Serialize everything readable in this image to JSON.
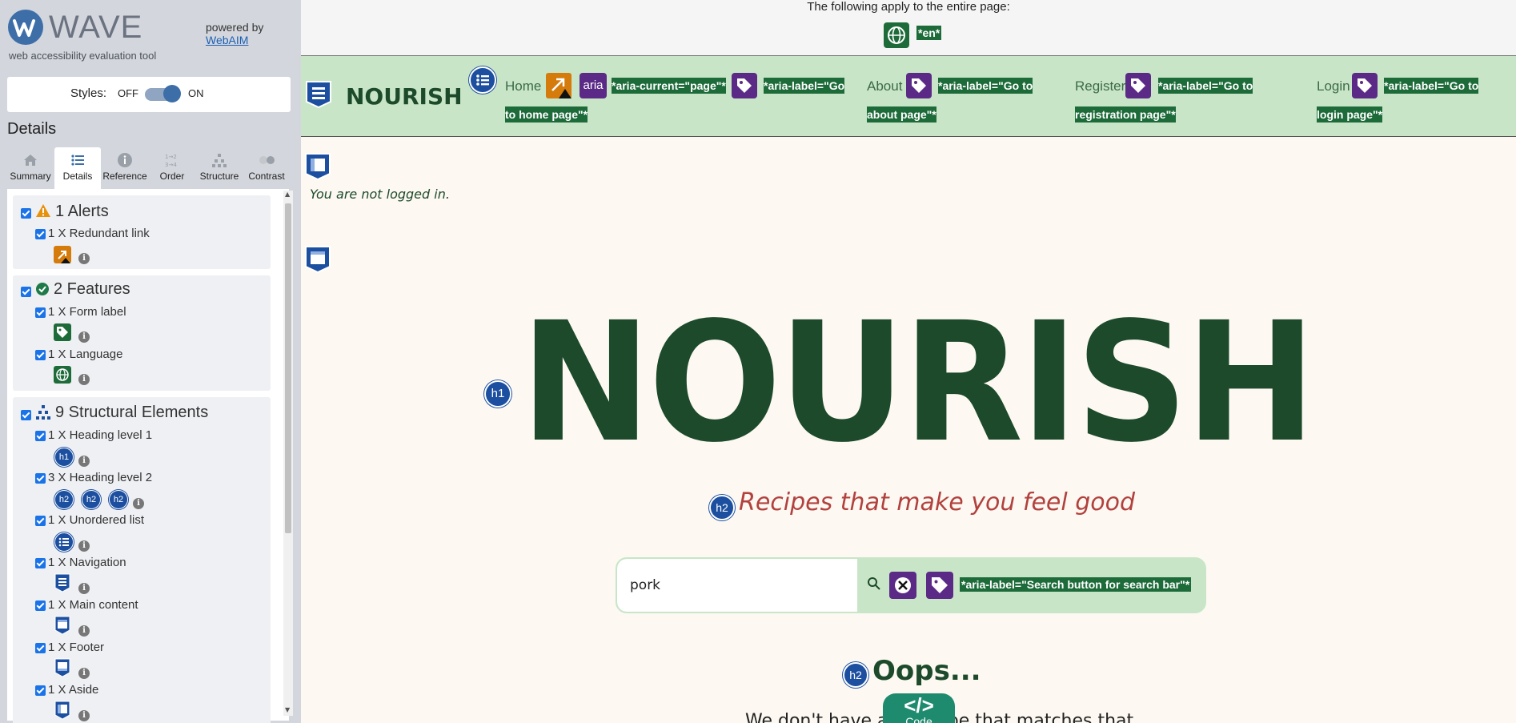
{
  "wave": {
    "title": "WAVE",
    "subtitle": "web accessibility evaluation tool",
    "powered_by": "powered by",
    "webaim_link": "WebAIM",
    "styles_label": "Styles:",
    "toggle_off": "OFF",
    "toggle_on": "ON",
    "details_heading": "Details",
    "tabs": [
      {
        "label": "Summary",
        "icon": "home-icon"
      },
      {
        "label": "Details",
        "icon": "list-icon"
      },
      {
        "label": "Reference",
        "icon": "info-icon"
      },
      {
        "label": "Order",
        "icon": "order-icon"
      },
      {
        "label": "Structure",
        "icon": "structure-icon"
      },
      {
        "label": "Contrast",
        "icon": "contrast-icon"
      }
    ],
    "active_tab": "Details",
    "groups": {
      "alerts": {
        "title": "1 Alerts",
        "items": [
          {
            "label": "1 X Redundant link",
            "icon": "redundant-link-icon"
          }
        ]
      },
      "features": {
        "title": "2 Features",
        "items": [
          {
            "label": "1 X Form label",
            "icon": "form-label-icon"
          },
          {
            "label": "1 X Language",
            "icon": "language-icon"
          }
        ]
      },
      "structure": {
        "title": "9 Structural Elements",
        "items": [
          {
            "label": "1 X Heading level 1",
            "badges": [
              "h1"
            ]
          },
          {
            "label": "3 X Heading level 2",
            "badges": [
              "h2",
              "h2",
              "h2"
            ]
          },
          {
            "label": "1 X Unordered list",
            "icon": "unordered-list-icon"
          },
          {
            "label": "1 X Navigation",
            "icon": "navigation-icon"
          },
          {
            "label": "1 X Main content",
            "icon": "main-content-icon"
          },
          {
            "label": "1 X Footer",
            "icon": "footer-icon"
          },
          {
            "label": "1 X Aside",
            "icon": "aside-icon"
          }
        ]
      }
    },
    "info_glyph": "i"
  },
  "page": {
    "applies_text": "The following apply to the entire page:",
    "lang_tag": "*en*",
    "brand": "NOURISH",
    "nav": {
      "home": "Home",
      "aria_badge": "aria",
      "home_tag_1": "*aria-current=\"page\"*",
      "home_tag_2a": "*aria-label=\"Go",
      "home_tag_2b": "to home page\"*",
      "about": "About",
      "about_tag_a": "*aria-label=\"Go to",
      "about_tag_b": "about page\"*",
      "register": "Register",
      "register_tag_a": "*aria-label=\"Go to",
      "register_tag_b": "registration page\"*",
      "login": "Login",
      "login_tag_a": "*aria-label=\"Go to",
      "login_tag_b": "login page\"*"
    },
    "login_status": "You are not logged in.",
    "h1_badge": "h1",
    "hero_title": "NOURISH",
    "h2_badge": "h2",
    "tagline": "Recipes that make you feel good",
    "search": {
      "value": "pork",
      "tag": "*aria-label=\"Search button for search bar\"*"
    },
    "oops": "Oops...",
    "partial_text": "We don't have any recipe that matches that",
    "code_glyph": "</>",
    "code_label": "Code"
  },
  "colors": {
    "sidebar_bg": "#d3d6dc",
    "wave_blue": "#3d6ea8",
    "feature_green": "#1e6b3a",
    "aria_purple": "#5b2a86",
    "alert_orange": "#d57b0c",
    "structure_blue": "#1c4fa0",
    "brand_green": "#1d4a2b",
    "header_green": "#c8e6c7",
    "tagline_red": "#b2413e",
    "page_bg": "#fdf9f2"
  }
}
